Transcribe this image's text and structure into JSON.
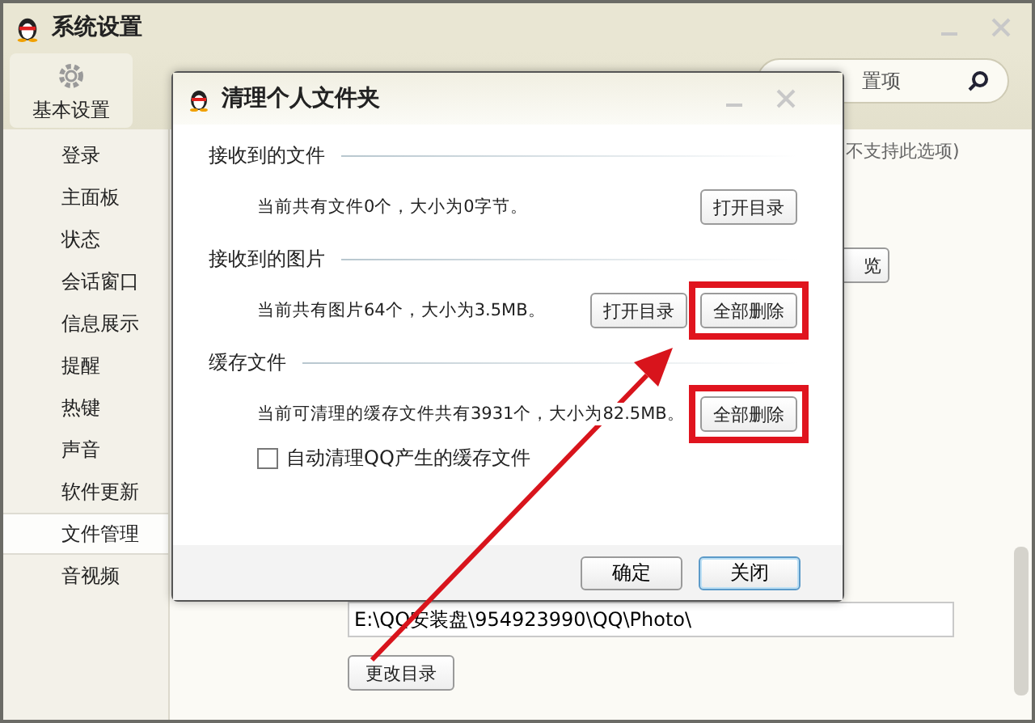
{
  "window": {
    "title": "系统设置"
  },
  "toolbar": {
    "tabs": [
      {
        "label": "基本设置",
        "selected": true
      }
    ],
    "search": {
      "placeholder": "置项"
    }
  },
  "sidebar": {
    "items": [
      {
        "label": "登录",
        "selected": false
      },
      {
        "label": "主面板",
        "selected": false
      },
      {
        "label": "状态",
        "selected": false
      },
      {
        "label": "会话窗口",
        "selected": false
      },
      {
        "label": "信息展示",
        "selected": false
      },
      {
        "label": "提醒",
        "selected": false
      },
      {
        "label": "热键",
        "selected": false
      },
      {
        "label": "声音",
        "selected": false
      },
      {
        "label": "软件更新",
        "selected": false
      },
      {
        "label": "文件管理",
        "selected": true
      },
      {
        "label": "音视频",
        "selected": false
      }
    ]
  },
  "content": {
    "note": "不支持此选项)",
    "browse_button": "览",
    "path_field": {
      "value": "E:\\QQ安装盘\\954923990\\QQ\\Photo\\"
    },
    "change_dir_button": "更改目录"
  },
  "dialog": {
    "title": "清理个人文件夹",
    "sections": [
      {
        "heading": "接收到的文件",
        "text": "当前共有文件0个，大小为0字节。",
        "buttons": [
          {
            "label": "打开目录",
            "highlighted": false
          }
        ]
      },
      {
        "heading": "接收到的图片",
        "text": "当前共有图片64个，大小为3.5MB。",
        "buttons": [
          {
            "label": "打开目录",
            "highlighted": false
          },
          {
            "label": "全部删除",
            "highlighted": true
          }
        ]
      },
      {
        "heading": "缓存文件",
        "text": "当前可清理的缓存文件共有3931个，大小为82.5MB。",
        "buttons": [
          {
            "label": "全部删除",
            "highlighted": true
          }
        ]
      }
    ],
    "checkbox": {
      "label": "自动清理QQ产生的缓存文件",
      "checked": false
    },
    "buttons": [
      {
        "label": "确定",
        "default": false
      },
      {
        "label": "关闭",
        "default": true
      }
    ]
  },
  "annotation": {
    "kind": "arrow"
  }
}
